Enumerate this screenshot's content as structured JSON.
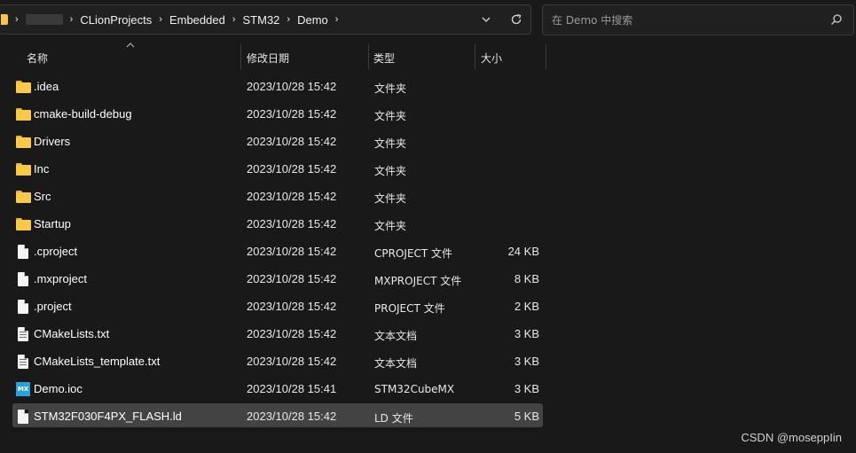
{
  "breadcrumb": {
    "items": [
      "CLionProjects",
      "Embedded",
      "STM32",
      "Demo"
    ],
    "separator": "›"
  },
  "address_controls": {
    "dropdown_icon": "chevron-down-icon",
    "refresh_icon": "refresh-icon"
  },
  "search": {
    "placeholder": "在 Demo 中搜索"
  },
  "columns": {
    "name": "名称",
    "date": "修改日期",
    "type": "类型",
    "size": "大小"
  },
  "files": [
    {
      "name": ".idea",
      "date": "2023/10/28 15:42",
      "type": "文件夹",
      "size": "",
      "icon": "folder-icon"
    },
    {
      "name": "cmake-build-debug",
      "date": "2023/10/28 15:42",
      "type": "文件夹",
      "size": "",
      "icon": "folder-icon"
    },
    {
      "name": "Drivers",
      "date": "2023/10/28 15:42",
      "type": "文件夹",
      "size": "",
      "icon": "folder-icon"
    },
    {
      "name": "Inc",
      "date": "2023/10/28 15:42",
      "type": "文件夹",
      "size": "",
      "icon": "folder-icon"
    },
    {
      "name": "Src",
      "date": "2023/10/28 15:42",
      "type": "文件夹",
      "size": "",
      "icon": "folder-icon"
    },
    {
      "name": "Startup",
      "date": "2023/10/28 15:42",
      "type": "文件夹",
      "size": "",
      "icon": "folder-icon"
    },
    {
      "name": ".cproject",
      "date": "2023/10/28 15:42",
      "type": "CPROJECT 文件",
      "size": "24 KB",
      "icon": "file-icon"
    },
    {
      "name": ".mxproject",
      "date": "2023/10/28 15:42",
      "type": "MXPROJECT 文件",
      "size": "8 KB",
      "icon": "file-icon"
    },
    {
      "name": ".project",
      "date": "2023/10/28 15:42",
      "type": "PROJECT 文件",
      "size": "2 KB",
      "icon": "file-icon"
    },
    {
      "name": "CMakeLists.txt",
      "date": "2023/10/28 15:42",
      "type": "文本文档",
      "size": "3 KB",
      "icon": "text-file-icon"
    },
    {
      "name": "CMakeLists_template.txt",
      "date": "2023/10/28 15:42",
      "type": "文本文档",
      "size": "3 KB",
      "icon": "text-file-icon"
    },
    {
      "name": "Demo.ioc",
      "date": "2023/10/28 15:41",
      "type": "STM32CubeMX",
      "size": "3 KB",
      "icon": "stm32cubemx-icon",
      "icon_text": "MX"
    },
    {
      "name": "STM32F030F4PX_FLASH.ld",
      "date": "2023/10/28 15:42",
      "type": "LD 文件",
      "size": "5 KB",
      "icon": "file-icon",
      "selected": true
    }
  ],
  "watermark": "CSDN @moseppIin",
  "colors": {
    "background": "#191919",
    "selected_row": "#434343",
    "folder": "#f8c94b",
    "mx_icon": "#2aa3d9"
  }
}
